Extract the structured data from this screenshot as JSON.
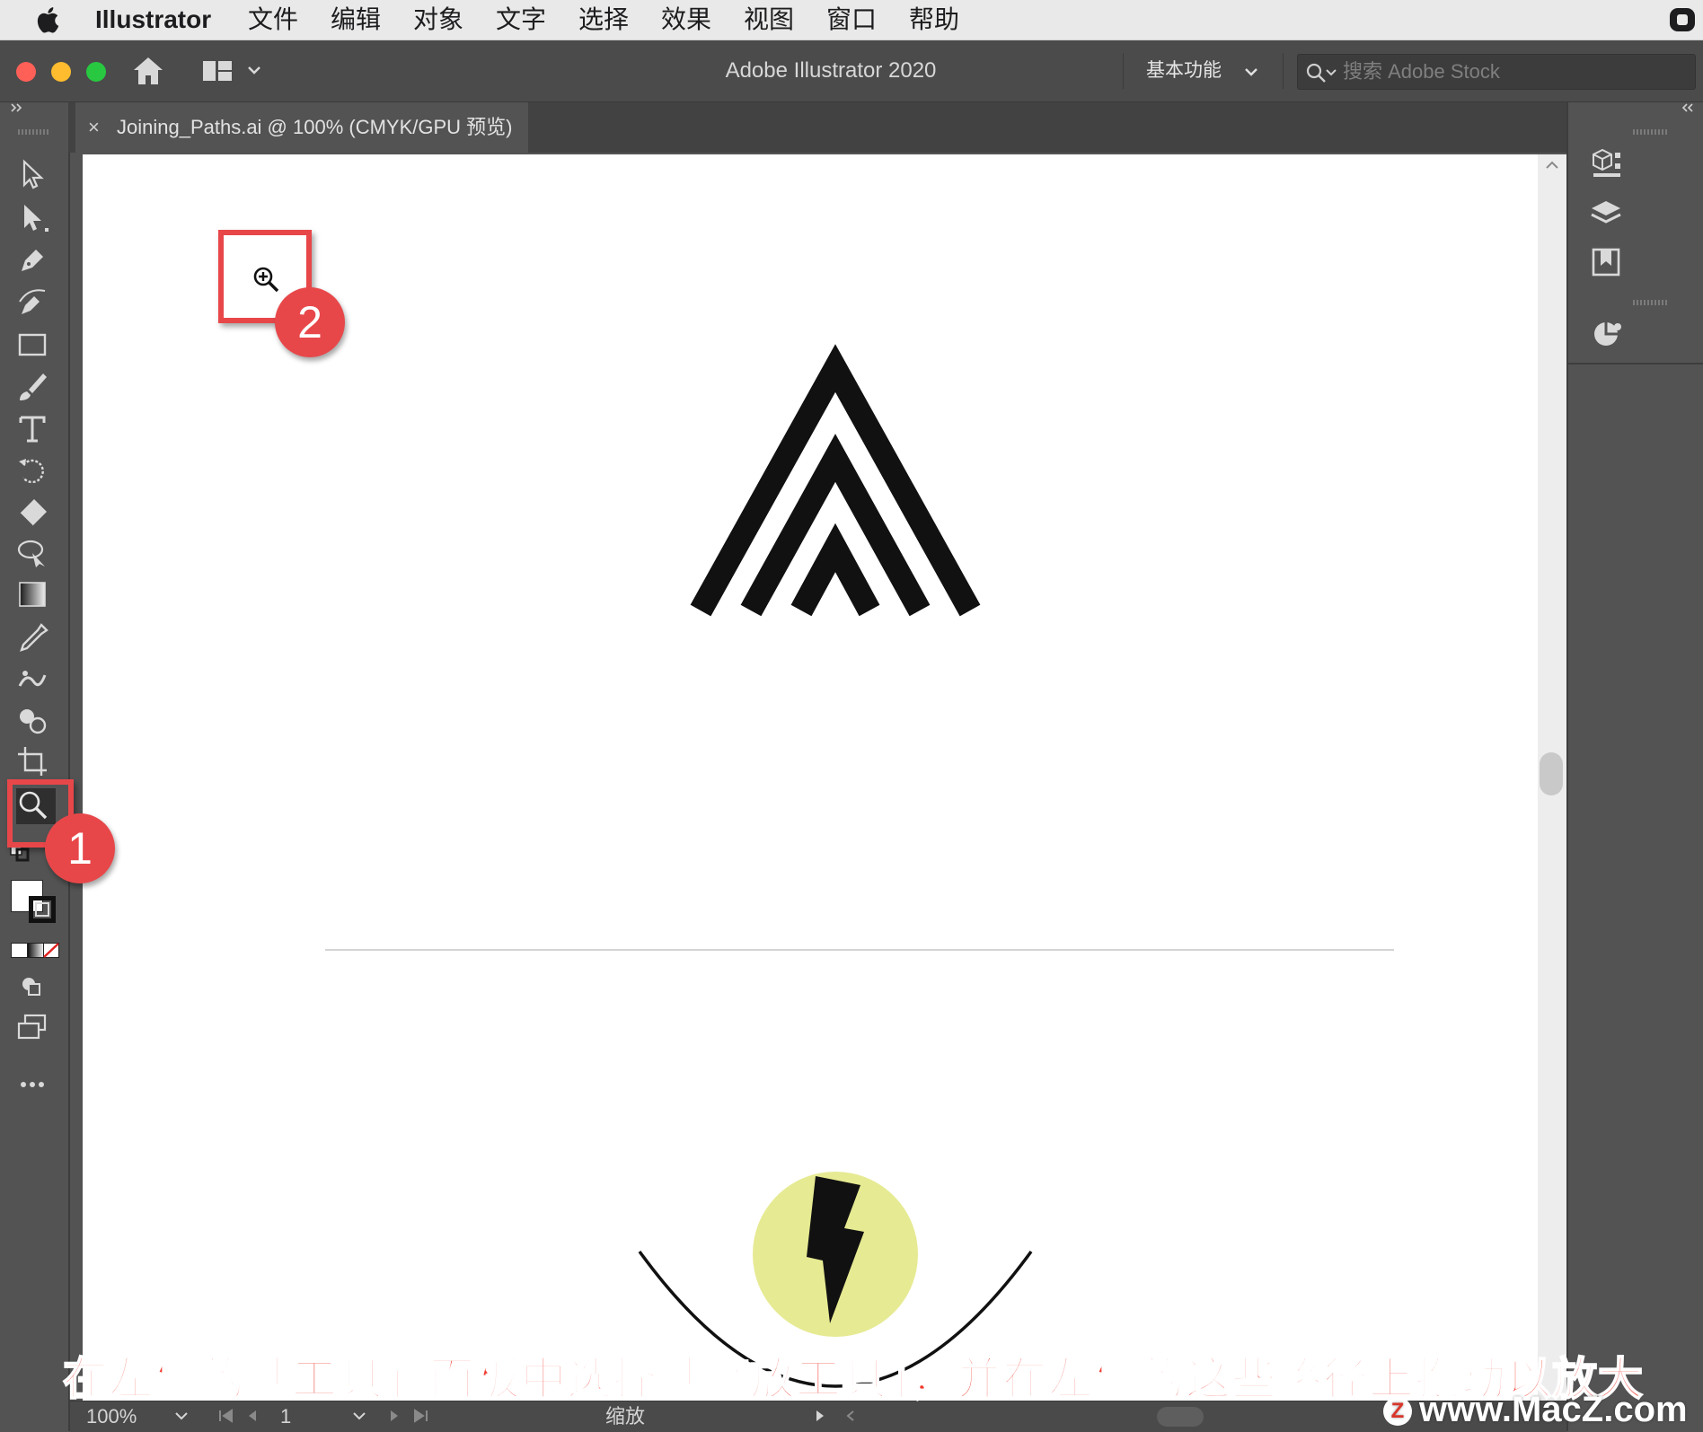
{
  "menubar": {
    "app_name": "Illustrator",
    "items": [
      "文件",
      "编辑",
      "对象",
      "文字",
      "选择",
      "效果",
      "视图",
      "窗口",
      "帮助"
    ]
  },
  "titlebar": {
    "title": "Adobe Illustrator 2020",
    "workspace": "基本功能",
    "search_placeholder": "搜索 Adobe Stock"
  },
  "tab": {
    "close": "×",
    "name": "Joining_Paths.ai @ 100% (CMYK/GPU 预览)"
  },
  "statusbar": {
    "zoom": "100%",
    "page": "1",
    "tool_name": "缩放"
  },
  "callouts": [
    "1",
    "2"
  ],
  "caption": "在左侧的「工具」面板中选择「缩放工具」，并在左侧的这些路径上拖动以放大",
  "watermark": "www.MacZ.com",
  "colors": {
    "accent_red": "#e8474a",
    "bolt_circle": "#e6ea92",
    "caption_red": "#f03a2e"
  }
}
